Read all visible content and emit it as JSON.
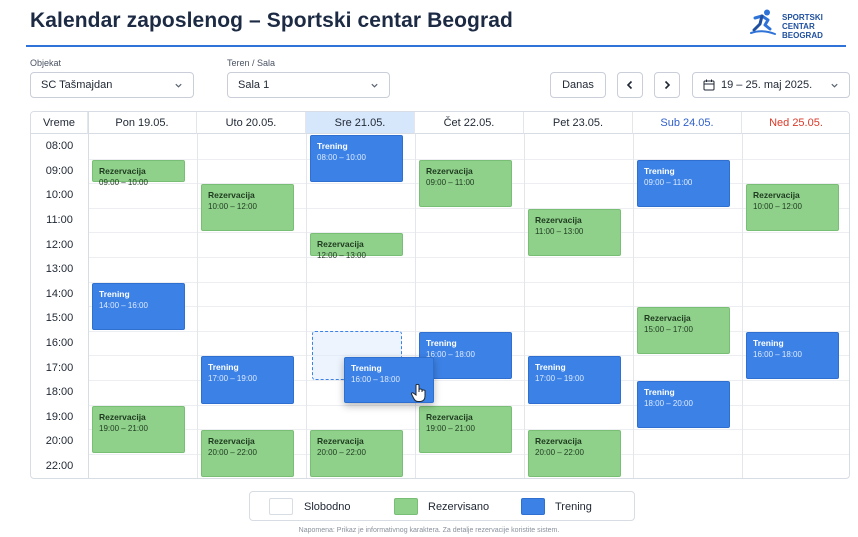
{
  "header": {
    "title": "Kalendar zaposlenog – Sportski centar Beograd",
    "logo_line1": "SPORTSKI CENTAR",
    "logo_line2": "BEOGRAD"
  },
  "filters": {
    "objekat_label": "Objekat",
    "objekat_value": "SC Tašmajdan",
    "teren_label": "Teren / Sala",
    "teren_value": "Sala 1"
  },
  "toolbar": {
    "today_label": "Danas",
    "date_range": "19 – 25. maj 2025."
  },
  "calendar": {
    "time_header": "Vreme",
    "days": [
      {
        "label": "Pon 19.05.",
        "kind": "normal"
      },
      {
        "label": "Uto 20.05.",
        "kind": "normal"
      },
      {
        "label": "Sre 21.05.",
        "kind": "today"
      },
      {
        "label": "Čet 22.05.",
        "kind": "normal"
      },
      {
        "label": "Pet 23.05.",
        "kind": "normal"
      },
      {
        "label": "Sub 24.05.",
        "kind": "sat"
      },
      {
        "label": "Ned 25.05.",
        "kind": "sun"
      }
    ],
    "hours": [
      "08:00",
      "09:00",
      "10:00",
      "11:00",
      "12:00",
      "13:00",
      "14:00",
      "15:00",
      "16:00",
      "17:00",
      "18:00",
      "19:00",
      "20:00",
      "22:00"
    ],
    "events": [
      {
        "day": 0,
        "start": 9,
        "end": 10,
        "type": "res",
        "title": "Rezervacija",
        "time": "09:00 – 10:00"
      },
      {
        "day": 0,
        "start": 14,
        "end": 16,
        "type": "tr",
        "title": "Trening",
        "time": "14:00 – 16:00"
      },
      {
        "day": 0,
        "start": 19,
        "end": 21,
        "type": "res",
        "title": "Rezervacija",
        "time": "19:00 – 21:00"
      },
      {
        "day": 1,
        "start": 10,
        "end": 12,
        "type": "res",
        "title": "Rezervacija",
        "time": "10:00 – 12:00"
      },
      {
        "day": 1,
        "start": 17,
        "end": 19,
        "type": "tr",
        "title": "Trening",
        "time": "17:00 – 19:00"
      },
      {
        "day": 1,
        "start": 20,
        "end": 22,
        "type": "res",
        "title": "Rezervacija",
        "time": "20:00 – 22:00"
      },
      {
        "day": 2,
        "start": 8,
        "end": 10,
        "type": "tr",
        "title": "Trening",
        "time": "08:00 – 10:00"
      },
      {
        "day": 2,
        "start": 12,
        "end": 13,
        "type": "res",
        "title": "Rezervacija",
        "time": "12:00 – 13:00"
      },
      {
        "day": 2,
        "start": 20,
        "end": 22,
        "type": "res",
        "title": "Rezervacija",
        "time": "20:00 – 22:00"
      },
      {
        "day": 3,
        "start": 9,
        "end": 11,
        "type": "res",
        "title": "Rezervacija",
        "time": "09:00 – 11:00"
      },
      {
        "day": 3,
        "start": 16,
        "end": 18,
        "type": "tr",
        "title": "Trening",
        "time": "16:00 – 18:00"
      },
      {
        "day": 3,
        "start": 19,
        "end": 21,
        "type": "res",
        "title": "Rezervacija",
        "time": "19:00 – 21:00"
      },
      {
        "day": 4,
        "start": 11,
        "end": 13,
        "type": "res",
        "title": "Rezervacija",
        "time": "11:00 – 13:00"
      },
      {
        "day": 4,
        "start": 17,
        "end": 19,
        "type": "tr",
        "title": "Trening",
        "time": "17:00 – 19:00"
      },
      {
        "day": 4,
        "start": 20,
        "end": 22,
        "type": "res",
        "title": "Rezervacija",
        "time": "20:00 – 22:00"
      },
      {
        "day": 5,
        "start": 9,
        "end": 11,
        "type": "tr",
        "title": "Trening",
        "time": "09:00 – 11:00"
      },
      {
        "day": 5,
        "start": 15,
        "end": 17,
        "type": "res",
        "title": "Rezervacija",
        "time": "15:00 – 17:00"
      },
      {
        "day": 5,
        "start": 18,
        "end": 20,
        "type": "tr",
        "title": "Trening",
        "time": "18:00 – 20:00"
      },
      {
        "day": 6,
        "start": 10,
        "end": 12,
        "type": "res",
        "title": "Rezervacija",
        "time": "10:00 – 12:00"
      },
      {
        "day": 6,
        "start": 16,
        "end": 18,
        "type": "tr",
        "title": "Trening",
        "time": "16:00 – 18:00"
      }
    ],
    "dragged_event": {
      "title": "Trening",
      "time": "16:00 – 18:00"
    }
  },
  "legend": {
    "free": "Slobodno",
    "reserved": "Rezervisano",
    "training": "Trening"
  },
  "footer_note": "Napomena: Prikaz je informativnog karaktera. Za detalje rezervacije koristite sistem.",
  "colors": {
    "accent": "#2f73d8",
    "reserved": "#8fd18b",
    "training": "#3c82e6",
    "today_header": "#d6e6fb",
    "saturday": "#2f5fc9",
    "sunday": "#d93a2a"
  }
}
